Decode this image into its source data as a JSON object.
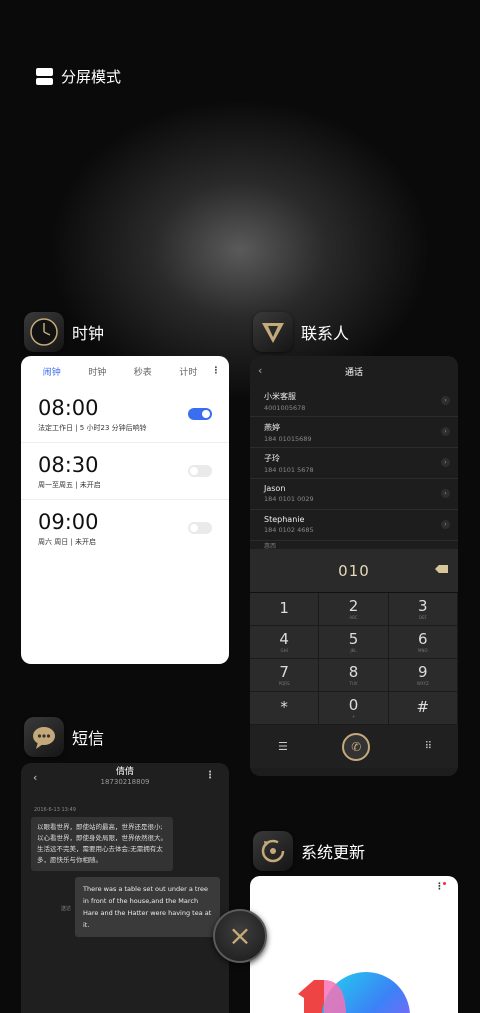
{
  "split_mode": {
    "label": "分屏模式"
  },
  "clock": {
    "app_name": "时钟",
    "tabs": [
      "闹钟",
      "时钟",
      "秒表",
      "计时"
    ],
    "alarms": [
      {
        "time": "08:00",
        "desc": "法定工作日 | 5 小时23 分钟后响铃",
        "enabled": true
      },
      {
        "time": "08:30",
        "desc": "周一至周五 | 未开启",
        "enabled": false
      },
      {
        "time": "09:00",
        "desc": "周六 周日 | 未开启",
        "enabled": false
      }
    ]
  },
  "contacts": {
    "app_name": "联系人",
    "title": "通话",
    "list": [
      {
        "name": "小米客服",
        "number": "4001005678"
      },
      {
        "name": "燕婷",
        "number": "184 01015689"
      },
      {
        "name": "子玲",
        "number": "184 0101 5678"
      },
      {
        "name": "Jason",
        "number": "184 0101 0029"
      },
      {
        "name": "Stephanie",
        "number": "184 0102 4685"
      }
    ],
    "list_cut": "惠西",
    "dialer_number": "010",
    "keys": [
      {
        "digit": "1",
        "letters": ""
      },
      {
        "digit": "2",
        "letters": "ABC"
      },
      {
        "digit": "3",
        "letters": "DEF"
      },
      {
        "digit": "4",
        "letters": "GHI"
      },
      {
        "digit": "5",
        "letters": "JKL"
      },
      {
        "digit": "6",
        "letters": "MNO"
      },
      {
        "digit": "7",
        "letters": "PQRS"
      },
      {
        "digit": "8",
        "letters": "TUV"
      },
      {
        "digit": "9",
        "letters": "WXYZ"
      },
      {
        "digit": "*",
        "letters": ""
      },
      {
        "digit": "0",
        "letters": "+"
      },
      {
        "digit": "#",
        "letters": ""
      }
    ]
  },
  "messages": {
    "app_name": "短信",
    "contact_name": "倩倩",
    "contact_phone": "18730218809",
    "date": "2016-6-13 13:49",
    "incoming": "以眼看世界，即使站的最高，世界还是很小;以心看世界，即使身处局限，世界依然很大。生活远不完美，需要用心去体会;无需拥有太多，愿快乐与你相随。",
    "outgoing_label": "送达",
    "outgoing": "There was a table set out under a tree in front of the house,and the March Hare and the Hatter were having tea at it."
  },
  "update": {
    "app_name": "系统更新"
  },
  "close_icon": "close-icon",
  "colors": {
    "accent_blue": "#3b6df0",
    "gold": "#c8aa78"
  }
}
